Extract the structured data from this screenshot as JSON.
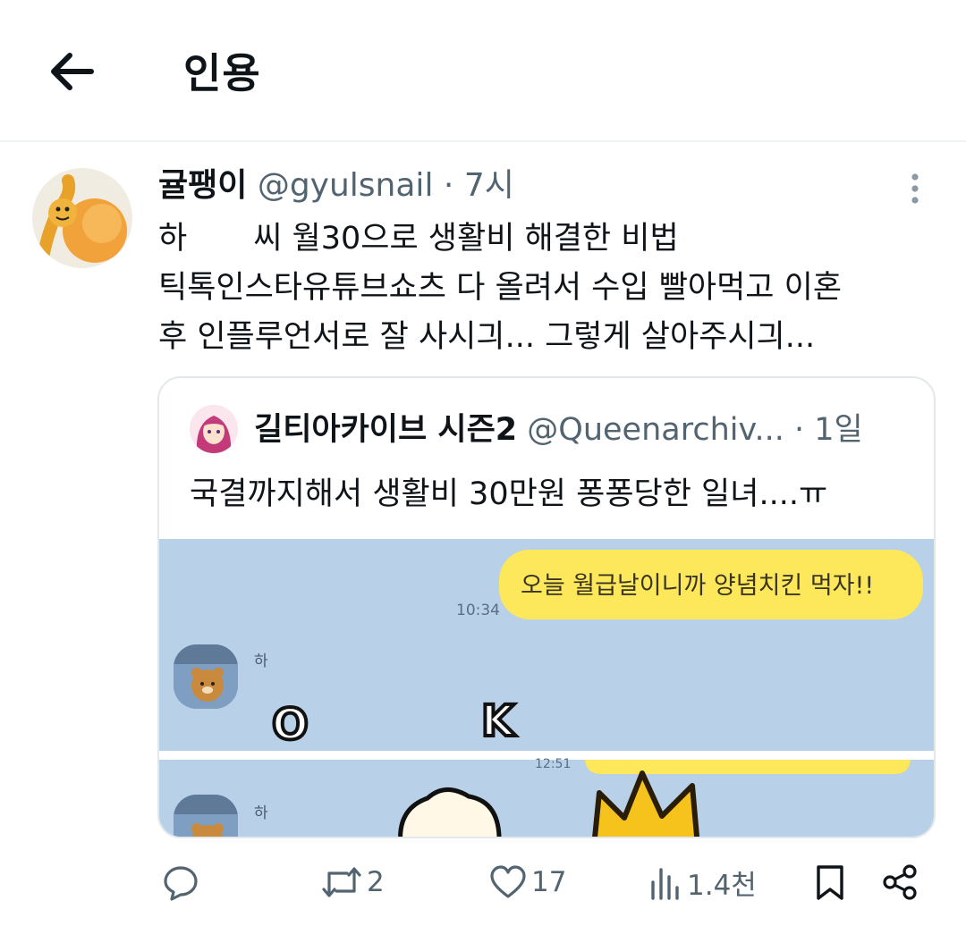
{
  "header": {
    "title": "인용"
  },
  "tweet": {
    "name": "귤팽이",
    "handle": "@gyulsnail",
    "dot": "·",
    "time": "7시",
    "line1_a": "하",
    "line1_b": "씨 월30으로 생활비 해결한 비법",
    "line2": "틱톡인스타유튜브쇼츠 다 올려서 수입 빨아먹고 이혼",
    "line3": "후 인플루언서로 잘 사시긔... 그렇게 살아주시긔..."
  },
  "quote": {
    "name": "길티아카이브 시즌2",
    "handle": "@Queenarchiv...",
    "dot": "·",
    "time": "1일",
    "text": "국결까지해서 생활비 30만원 퐁퐁당한 일녀....ㅠ",
    "chat": {
      "bubble": "오늘 월급날이니까 양념치킨 먹자!!",
      "time": "10:34",
      "time2": "12:51",
      "sender": "하",
      "sticker_o": "O",
      "sticker_k": "K"
    }
  },
  "actions": {
    "reply_count": "",
    "retweet_count": "2",
    "like_count": "17",
    "views_count": "1.4천"
  },
  "icons": {
    "back": "arrow-left-icon",
    "more": "more-vertical-icon",
    "reply": "reply-icon",
    "retweet": "retweet-icon",
    "like": "heart-icon",
    "views": "views-icon",
    "bookmark": "bookmark-icon",
    "share": "share-icon"
  },
  "colors": {
    "text": "#0f1419",
    "secondary": "#536471",
    "bubble": "#fde75a",
    "chat_bg": "#b8d0e8"
  }
}
